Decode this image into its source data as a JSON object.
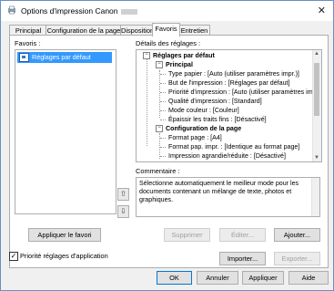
{
  "window": {
    "title": "Options d'impression Canon",
    "close_glyph": "✕"
  },
  "tabs": [
    {
      "label": "Principal"
    },
    {
      "label": "Configuration de la page"
    },
    {
      "label": "Disposition"
    },
    {
      "label": "Favoris",
      "active": true
    },
    {
      "label": "Entretien"
    }
  ],
  "favoris": {
    "label": "Favoris :",
    "items": [
      {
        "label": "Réglages par défaut",
        "selected": true
      }
    ],
    "apply_button": "Appliquer le favori"
  },
  "details": {
    "label": "Détails des réglages :",
    "root": "Réglages par défaut",
    "principal": {
      "header": "Principal",
      "items": [
        "Type papier : [Auto (utiliser paramètres impr.)]",
        "But de l'impression : [Réglages par défaut]",
        "Priorité d'impression : [Auto (utiliser paramètres impr.)]",
        "Qualité d'impression : [Standard]",
        "Mode couleur : [Couleur]",
        "Épaissir les traits fins : [Désactivé]"
      ]
    },
    "config": {
      "header": "Configuration de la page",
      "items": [
        "Format page : [A4]",
        "Format pap. impr. : [Identique au format page]",
        "Impression agrandie/réduite : [Désactivé]"
      ]
    }
  },
  "comment": {
    "label": "Commentaire :",
    "text": "Sélectionne automatiquement le meilleur mode pour les documents contenant un mélange de texte, photos et graphiques."
  },
  "move_buttons": {
    "up": "⇧",
    "down": "⇩"
  },
  "buttons": {
    "supprimer": "Supprimer",
    "editer": "Éditer...",
    "ajouter": "Ajouter...",
    "importer": "Importer...",
    "exporter": "Exporter...",
    "ok": "OK",
    "annuler": "Annuler",
    "appliquer": "Appliquer",
    "aide": "Aide"
  },
  "priority_checkbox": {
    "label": "Priorité réglages d'application",
    "checked": true,
    "mark": "✓"
  }
}
